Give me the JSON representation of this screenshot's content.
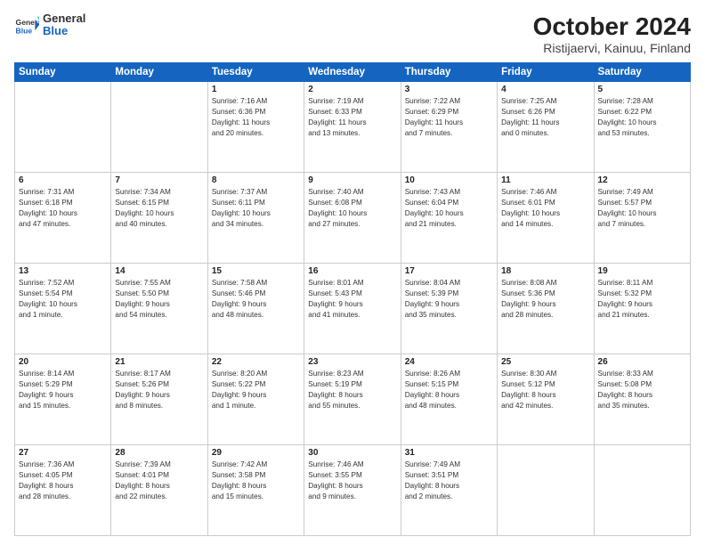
{
  "header": {
    "logo_general": "General",
    "logo_blue": "Blue",
    "title": "October 2024",
    "subtitle": "Ristijaervi, Kainuu, Finland"
  },
  "days_of_week": [
    "Sunday",
    "Monday",
    "Tuesday",
    "Wednesday",
    "Thursday",
    "Friday",
    "Saturday"
  ],
  "weeks": [
    [
      {
        "day": "",
        "info": ""
      },
      {
        "day": "",
        "info": ""
      },
      {
        "day": "1",
        "info": "Sunrise: 7:16 AM\nSunset: 6:36 PM\nDaylight: 11 hours\nand 20 minutes."
      },
      {
        "day": "2",
        "info": "Sunrise: 7:19 AM\nSunset: 6:33 PM\nDaylight: 11 hours\nand 13 minutes."
      },
      {
        "day": "3",
        "info": "Sunrise: 7:22 AM\nSunset: 6:29 PM\nDaylight: 11 hours\nand 7 minutes."
      },
      {
        "day": "4",
        "info": "Sunrise: 7:25 AM\nSunset: 6:26 PM\nDaylight: 11 hours\nand 0 minutes."
      },
      {
        "day": "5",
        "info": "Sunrise: 7:28 AM\nSunset: 6:22 PM\nDaylight: 10 hours\nand 53 minutes."
      }
    ],
    [
      {
        "day": "6",
        "info": "Sunrise: 7:31 AM\nSunset: 6:18 PM\nDaylight: 10 hours\nand 47 minutes."
      },
      {
        "day": "7",
        "info": "Sunrise: 7:34 AM\nSunset: 6:15 PM\nDaylight: 10 hours\nand 40 minutes."
      },
      {
        "day": "8",
        "info": "Sunrise: 7:37 AM\nSunset: 6:11 PM\nDaylight: 10 hours\nand 34 minutes."
      },
      {
        "day": "9",
        "info": "Sunrise: 7:40 AM\nSunset: 6:08 PM\nDaylight: 10 hours\nand 27 minutes."
      },
      {
        "day": "10",
        "info": "Sunrise: 7:43 AM\nSunset: 6:04 PM\nDaylight: 10 hours\nand 21 minutes."
      },
      {
        "day": "11",
        "info": "Sunrise: 7:46 AM\nSunset: 6:01 PM\nDaylight: 10 hours\nand 14 minutes."
      },
      {
        "day": "12",
        "info": "Sunrise: 7:49 AM\nSunset: 5:57 PM\nDaylight: 10 hours\nand 7 minutes."
      }
    ],
    [
      {
        "day": "13",
        "info": "Sunrise: 7:52 AM\nSunset: 5:54 PM\nDaylight: 10 hours\nand 1 minute."
      },
      {
        "day": "14",
        "info": "Sunrise: 7:55 AM\nSunset: 5:50 PM\nDaylight: 9 hours\nand 54 minutes."
      },
      {
        "day": "15",
        "info": "Sunrise: 7:58 AM\nSunset: 5:46 PM\nDaylight: 9 hours\nand 48 minutes."
      },
      {
        "day": "16",
        "info": "Sunrise: 8:01 AM\nSunset: 5:43 PM\nDaylight: 9 hours\nand 41 minutes."
      },
      {
        "day": "17",
        "info": "Sunrise: 8:04 AM\nSunset: 5:39 PM\nDaylight: 9 hours\nand 35 minutes."
      },
      {
        "day": "18",
        "info": "Sunrise: 8:08 AM\nSunset: 5:36 PM\nDaylight: 9 hours\nand 28 minutes."
      },
      {
        "day": "19",
        "info": "Sunrise: 8:11 AM\nSunset: 5:32 PM\nDaylight: 9 hours\nand 21 minutes."
      }
    ],
    [
      {
        "day": "20",
        "info": "Sunrise: 8:14 AM\nSunset: 5:29 PM\nDaylight: 9 hours\nand 15 minutes."
      },
      {
        "day": "21",
        "info": "Sunrise: 8:17 AM\nSunset: 5:26 PM\nDaylight: 9 hours\nand 8 minutes."
      },
      {
        "day": "22",
        "info": "Sunrise: 8:20 AM\nSunset: 5:22 PM\nDaylight: 9 hours\nand 1 minute."
      },
      {
        "day": "23",
        "info": "Sunrise: 8:23 AM\nSunset: 5:19 PM\nDaylight: 8 hours\nand 55 minutes."
      },
      {
        "day": "24",
        "info": "Sunrise: 8:26 AM\nSunset: 5:15 PM\nDaylight: 8 hours\nand 48 minutes."
      },
      {
        "day": "25",
        "info": "Sunrise: 8:30 AM\nSunset: 5:12 PM\nDaylight: 8 hours\nand 42 minutes."
      },
      {
        "day": "26",
        "info": "Sunrise: 8:33 AM\nSunset: 5:08 PM\nDaylight: 8 hours\nand 35 minutes."
      }
    ],
    [
      {
        "day": "27",
        "info": "Sunrise: 7:36 AM\nSunset: 4:05 PM\nDaylight: 8 hours\nand 28 minutes."
      },
      {
        "day": "28",
        "info": "Sunrise: 7:39 AM\nSunset: 4:01 PM\nDaylight: 8 hours\nand 22 minutes."
      },
      {
        "day": "29",
        "info": "Sunrise: 7:42 AM\nSunset: 3:58 PM\nDaylight: 8 hours\nand 15 minutes."
      },
      {
        "day": "30",
        "info": "Sunrise: 7:46 AM\nSunset: 3:55 PM\nDaylight: 8 hours\nand 9 minutes."
      },
      {
        "day": "31",
        "info": "Sunrise: 7:49 AM\nSunset: 3:51 PM\nDaylight: 8 hours\nand 2 minutes."
      },
      {
        "day": "",
        "info": ""
      },
      {
        "day": "",
        "info": ""
      }
    ]
  ]
}
